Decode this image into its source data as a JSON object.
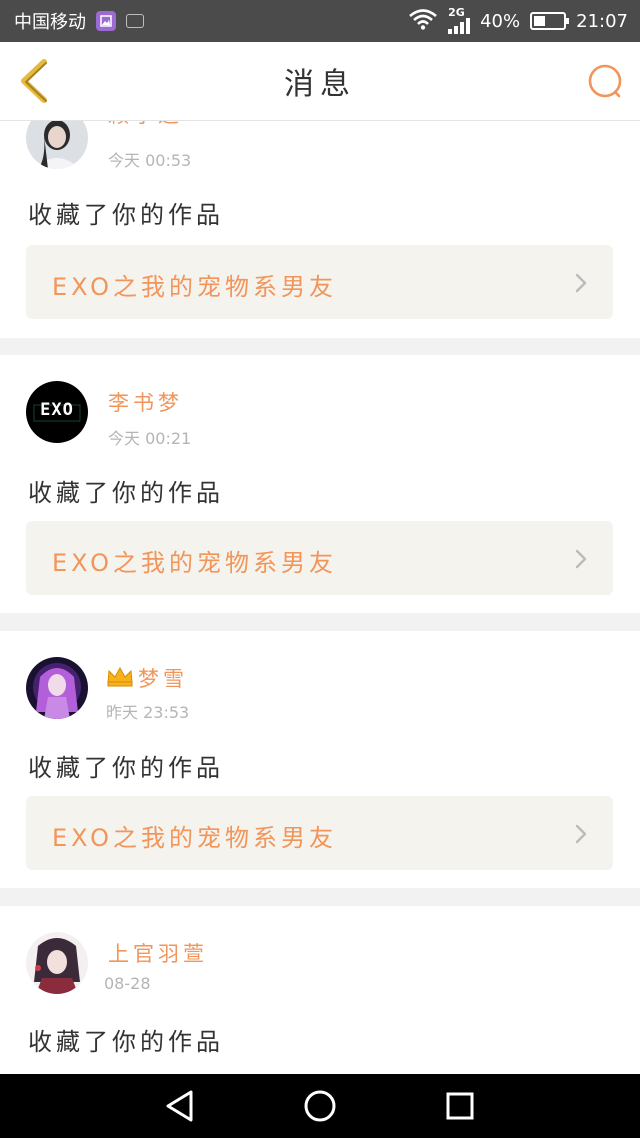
{
  "status_bar": {
    "carrier": "中国移动",
    "network": "2G",
    "battery": "40%",
    "battery_level": 0.4,
    "time": "21:07"
  },
  "header": {
    "title": "消息",
    "back_icon": "chevron-left-icon",
    "search_icon": "search-icon"
  },
  "messages": [
    {
      "username": "籁予遥",
      "time": "今天 00:53",
      "action": "收藏了你的作品",
      "work_title": "EXO之我的宠物系男友"
    },
    {
      "username": "李书梦",
      "time": "今天 00:21",
      "action": "收藏了你的作品",
      "work_title": "EXO之我的宠物系男友",
      "avatar_text": "EXO"
    },
    {
      "username": "梦雪",
      "time": "昨天 23:53",
      "action": "收藏了你的作品",
      "work_title": "EXO之我的宠物系男友",
      "badge": "crown-icon"
    },
    {
      "username": "上官羽萱",
      "time": "08-28",
      "action": "收藏了你的作品"
    }
  ],
  "nav": {
    "back": "triangle-back-icon",
    "home": "circle-home-icon",
    "recent": "square-recent-icon"
  },
  "colors": {
    "accent": "#f2955a",
    "status_bar": "#4b4b4b",
    "back_icon": "#e8b93a"
  }
}
